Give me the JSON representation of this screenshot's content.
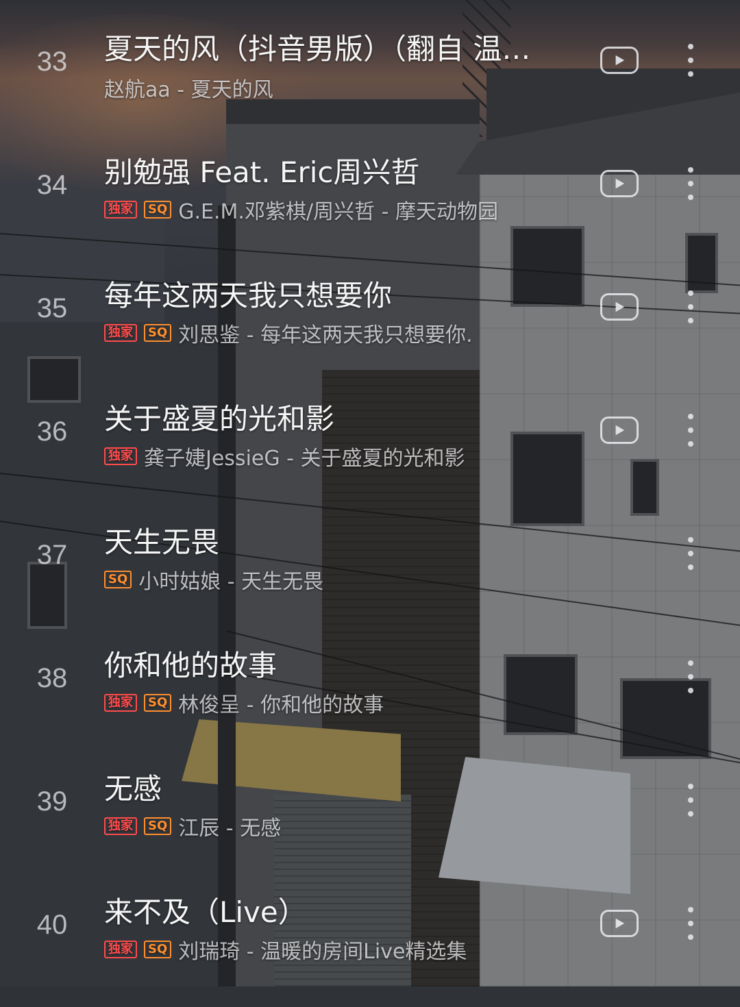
{
  "songs": [
    {
      "rank": "33",
      "title": "夏天的风（抖音男版）（翻自 温…",
      "subtitle": "赵航aa - 夏天的风",
      "exclusive": false,
      "sq": false,
      "play": true
    },
    {
      "rank": "34",
      "title": "别勉强 Feat. Eric周兴哲",
      "subtitle": "G.E.M.邓紫棋/周兴哲 - 摩天动物园",
      "exclusive": true,
      "sq": true,
      "play": true
    },
    {
      "rank": "35",
      "title": "每年这两天我只想要你",
      "subtitle": "刘思鉴 - 每年这两天我只想要你.",
      "exclusive": true,
      "sq": true,
      "play": true
    },
    {
      "rank": "36",
      "title": "关于盛夏的光和影",
      "subtitle": "龚子婕JessieG - 关于盛夏的光和影",
      "exclusive": true,
      "sq": false,
      "play": true
    },
    {
      "rank": "37",
      "title": "天生无畏",
      "subtitle": "小时姑娘 - 天生无畏",
      "exclusive": false,
      "sq": true,
      "play": false
    },
    {
      "rank": "38",
      "title": "你和他的故事",
      "subtitle": "林俊呈 - 你和他的故事",
      "exclusive": true,
      "sq": true,
      "play": false
    },
    {
      "rank": "39",
      "title": "无感",
      "subtitle": "江辰 - 无感",
      "exclusive": true,
      "sq": true,
      "play": false
    },
    {
      "rank": "40",
      "title": "来不及（Live）",
      "subtitle": "刘瑞琦 - 温暖的房间Live精选集",
      "exclusive": true,
      "sq": true,
      "play": true
    }
  ],
  "badges": {
    "exclusive": "独家",
    "sq": "SQ"
  },
  "colors": {
    "exclusive": "#ff4b4b",
    "sq": "#ff8f2e"
  },
  "icons": {
    "play": "play-icon",
    "more": "more-vertical-icon"
  }
}
